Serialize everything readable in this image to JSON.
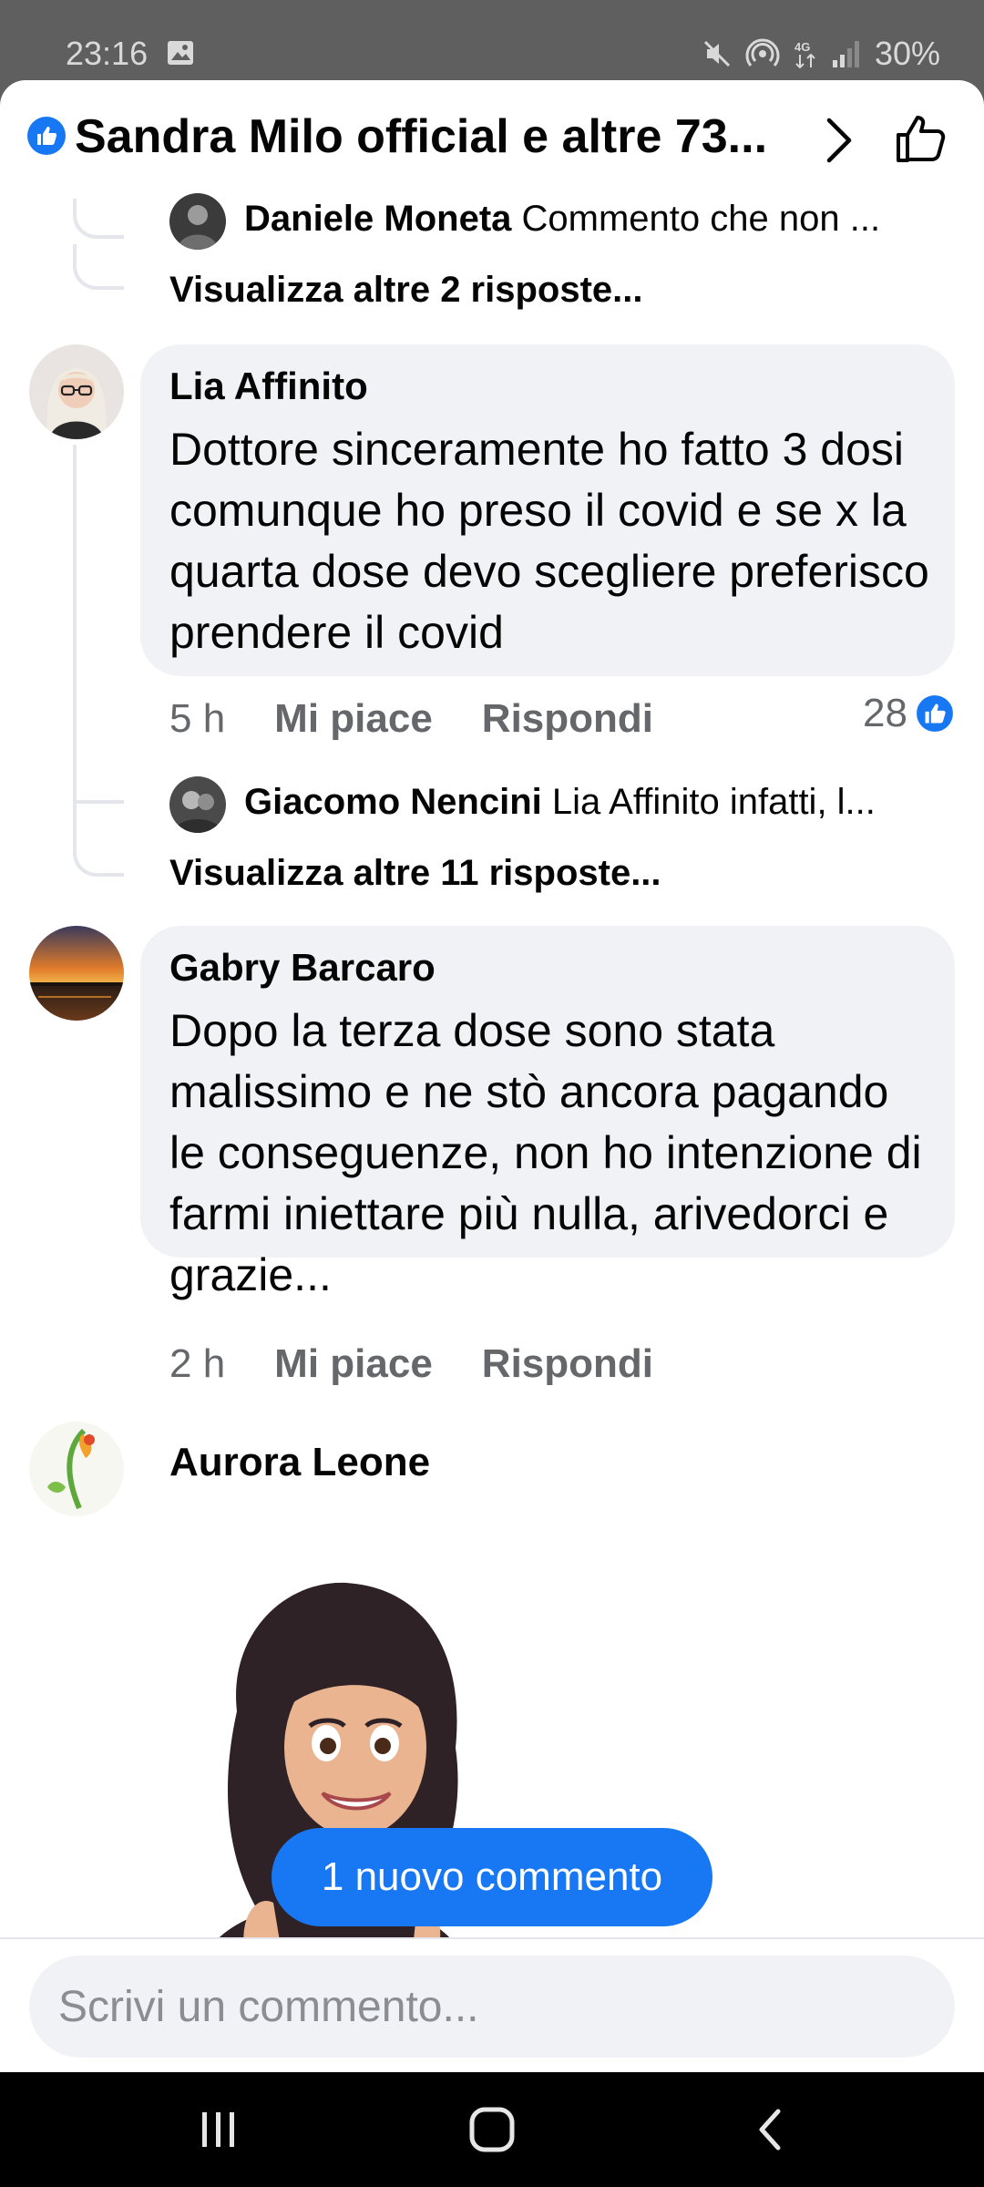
{
  "status_bar": {
    "time": "23:16",
    "battery": "30%",
    "icons": [
      "image-icon",
      "mute-icon",
      "hotspot-icon",
      "4g-icon",
      "signal-icon"
    ]
  },
  "header": {
    "title": "Sandra Milo official e altre 73...",
    "icons": [
      "like-badge-icon",
      "chevron-right-icon",
      "thumbs-up-icon"
    ]
  },
  "comments": [
    {
      "reply_preview": {
        "author": "Daniele Moneta",
        "text": "Commento che non ..."
      },
      "more_replies": "Visualizza altre 2 risposte..."
    },
    {
      "author": "Lia Affinito",
      "text": "Dottore sinceramente ho fatto 3 dosi comunque ho preso il covid e se x la quarta dose devo scegliere preferisco prendere il covid",
      "time": "5 h",
      "like_label": "Mi piace",
      "reply_label": "Rispondi",
      "reaction_count": "28",
      "reply_preview": {
        "author": "Giacomo Nencini",
        "text": "Lia Affinito infatti, l..."
      },
      "more_replies": "Visualizza altre 11 risposte..."
    },
    {
      "author": "Gabry Barcaro",
      "text": "Dopo la terza dose sono stata malissimo e ne stò ancora pagando le conseguenze, non ho intenzione di farmi iniettare più nulla, arivedorci e grazie...",
      "time": "2 h",
      "like_label": "Mi piace",
      "reply_label": "Rispondi"
    },
    {
      "author": "Aurora Leone"
    }
  ],
  "new_comment_pill": "1 nuovo commento",
  "composer": {
    "placeholder": "Scrivi un commento..."
  },
  "colors": {
    "accent": "#1877f2",
    "bubble": "#f0f2f5",
    "secondary_text": "#65676b"
  },
  "nav_bar": {
    "icons": [
      "recent-apps-icon",
      "home-icon",
      "back-icon"
    ]
  }
}
